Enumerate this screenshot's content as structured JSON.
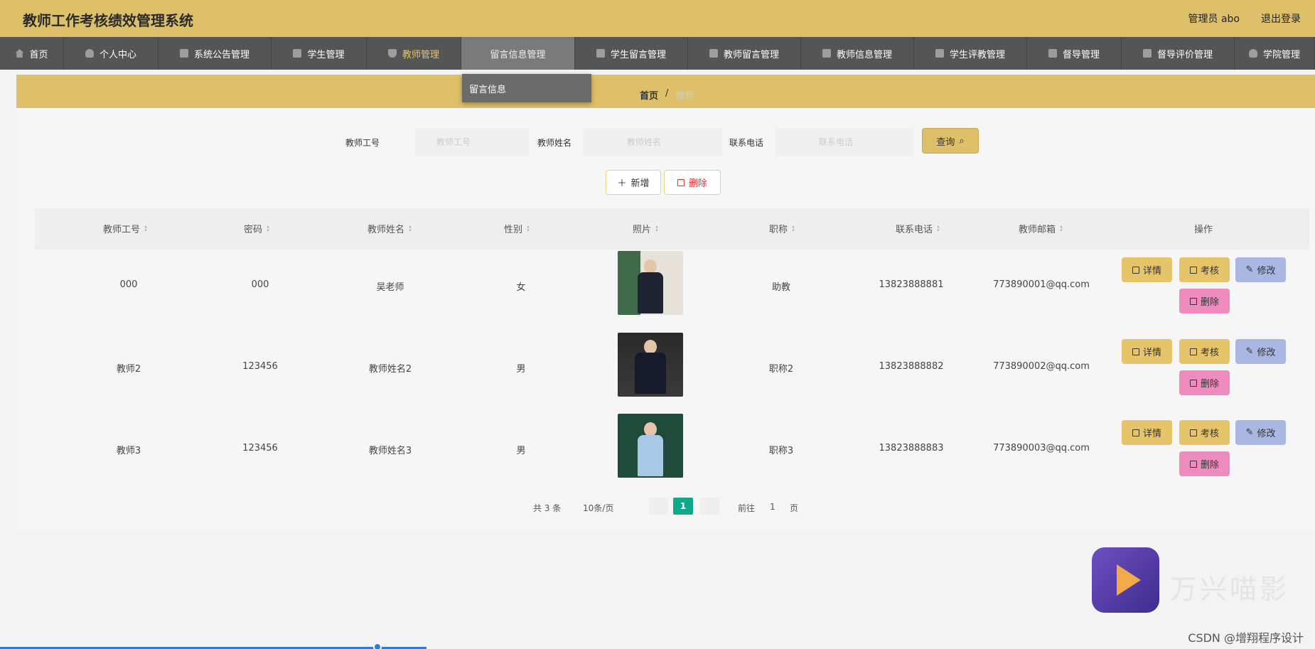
{
  "header": {
    "title": "教师工作考核绩效管理系统",
    "user": "管理员 abo",
    "logout": "退出登录"
  },
  "nav": [
    {
      "label": "首页",
      "icon": "home-icon"
    },
    {
      "label": "个人中心",
      "icon": "user-icon"
    },
    {
      "label": "系统公告管理",
      "icon": "doc-icon"
    },
    {
      "label": "学生管理",
      "icon": "card-icon"
    },
    {
      "label": "教师管理",
      "icon": "shield-icon"
    },
    {
      "label": "留言信息管理",
      "icon": ""
    },
    {
      "label": "学生留言管理",
      "icon": "doc-icon"
    },
    {
      "label": "教师留言管理",
      "icon": "list-icon"
    },
    {
      "label": "教师信息管理",
      "icon": "chart-icon"
    },
    {
      "label": "学生评教管理",
      "icon": "doc-icon"
    },
    {
      "label": "督导管理",
      "icon": "card-icon"
    },
    {
      "label": "督导评价管理",
      "icon": "cloud-icon"
    },
    {
      "label": "学院管理",
      "icon": "user-icon"
    }
  ],
  "dropdown": {
    "item": "留言信息"
  },
  "breadcrumb": {
    "home": "首页",
    "sep": "/",
    "current": "教师"
  },
  "filters": {
    "id_label": "教师工号",
    "id_placeholder": "教师工号",
    "name_label": "教师姓名",
    "name_placeholder": "教师姓名",
    "phone_label": "联系电话",
    "phone_placeholder": "联系电话",
    "query_label": "查询"
  },
  "toolbar": {
    "add_label": "新增",
    "delete_label": "删除"
  },
  "table": {
    "columns": [
      "教师工号",
      "密码",
      "教师姓名",
      "性别",
      "照片",
      "职称",
      "联系电话",
      "教师邮箱",
      "操作"
    ],
    "rows": [
      {
        "id": "000",
        "pwd": "000",
        "name": "吴老师",
        "gender": "女",
        "title": "助教",
        "phone": "13823888881",
        "email": "773890001@qq.com"
      },
      {
        "id": "教师2",
        "pwd": "123456",
        "name": "教师姓名2",
        "gender": "男",
        "title": "职称2",
        "phone": "13823888882",
        "email": "773890002@qq.com"
      },
      {
        "id": "教师3",
        "pwd": "123456",
        "name": "教师姓名3",
        "gender": "男",
        "title": "职称3",
        "phone": "13823888883",
        "email": "773890003@qq.com"
      }
    ],
    "actions": {
      "detail": "详情",
      "review": "考核",
      "edit": "修改",
      "delete": "删除"
    }
  },
  "pagination": {
    "total": "共 3 条",
    "page_size": "10条/页",
    "current": "1",
    "goto": "前往",
    "goto_value": "1",
    "page_unit": "页"
  },
  "watermark": {
    "brand": "万兴喵影",
    "csdn": "CSDN @增翔程序设计"
  },
  "colors": {
    "header": "#dfc06a",
    "nav": "#555555",
    "accent": "#10a98c",
    "edit": "#a9b8e3",
    "delete": "#f08bbf"
  }
}
